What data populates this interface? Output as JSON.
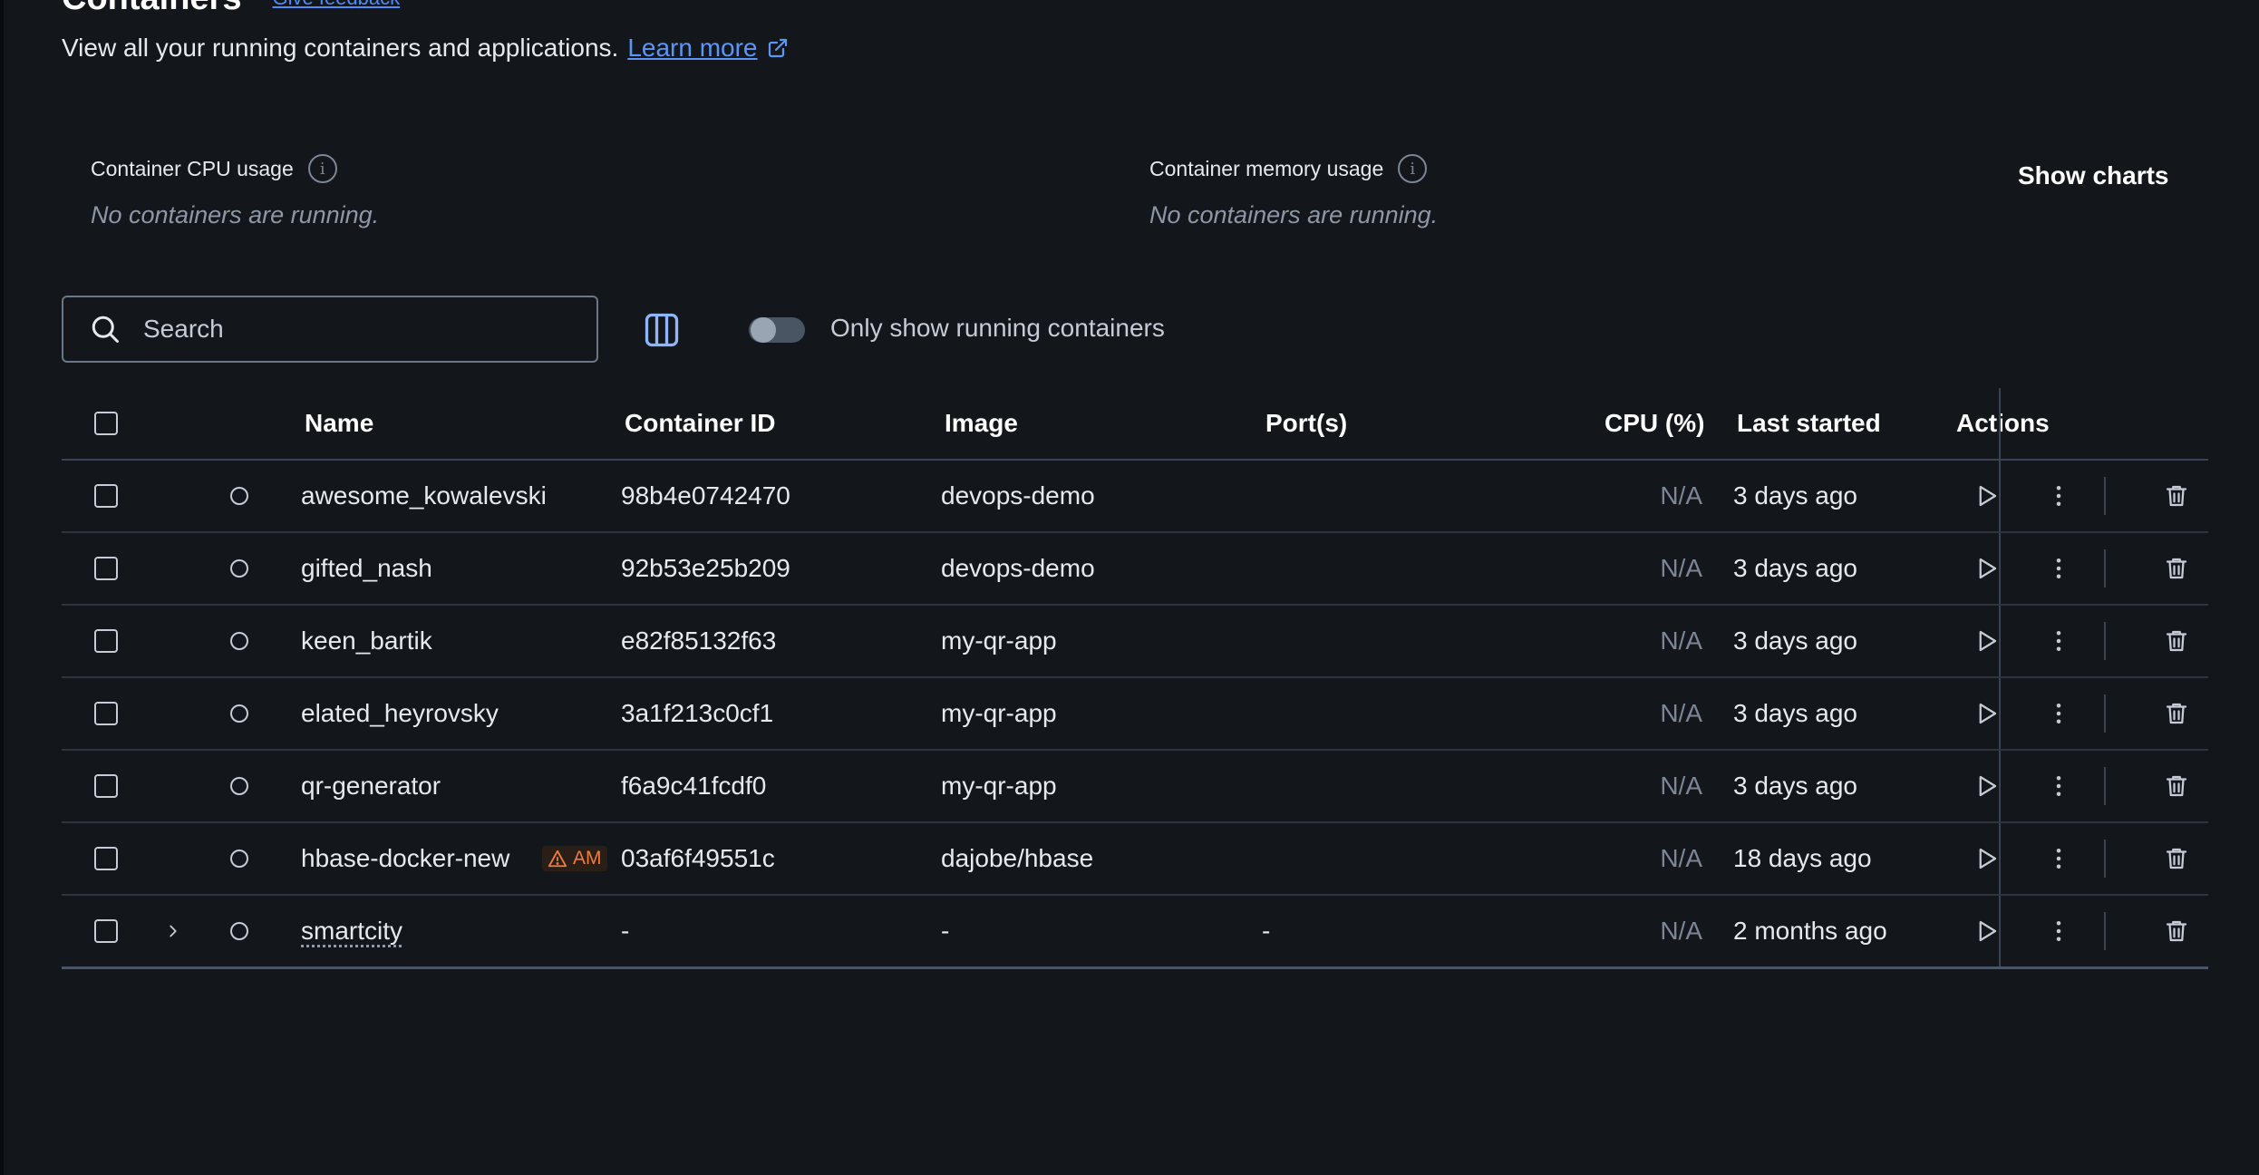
{
  "header": {
    "title": "Containers",
    "feedback_label": "Give feedback",
    "subtitle": "View all your running containers and applications.",
    "learn_more": "Learn more"
  },
  "stats": {
    "cpu": {
      "label": "Container CPU usage",
      "empty": "No containers are running."
    },
    "memory": {
      "label": "Container memory usage",
      "empty": "No containers are running."
    },
    "show_charts": "Show charts"
  },
  "toolbar": {
    "search_placeholder": "Search",
    "toggle_label": "Only show running containers",
    "toggle_on": false
  },
  "table": {
    "columns": {
      "name": "Name",
      "container_id": "Container ID",
      "image": "Image",
      "ports": "Port(s)",
      "cpu": "CPU (%)",
      "last_started": "Last started",
      "actions": "Actions"
    },
    "rows": [
      {
        "name": "awesome_kowalevski",
        "id": "98b4e0742470",
        "image": "devops-demo",
        "ports": "",
        "cpu": "N/A",
        "last_started": "3 days ago"
      },
      {
        "name": "gifted_nash",
        "id": "92b53e25b209",
        "image": "devops-demo",
        "ports": "",
        "cpu": "N/A",
        "last_started": "3 days ago"
      },
      {
        "name": "keen_bartik",
        "id": "e82f85132f63",
        "image": "my-qr-app",
        "ports": "",
        "cpu": "N/A",
        "last_started": "3 days ago"
      },
      {
        "name": "elated_heyrovsky",
        "id": "3a1f213c0cf1",
        "image": "my-qr-app",
        "ports": "",
        "cpu": "N/A",
        "last_started": "3 days ago"
      },
      {
        "name": "qr-generator",
        "id": "f6a9c41fcdf0",
        "image": "my-qr-app",
        "ports": "",
        "cpu": "N/A",
        "last_started": "3 days ago"
      },
      {
        "name": "hbase-docker-new",
        "badge": "AM",
        "id": "03af6f49551c",
        "image": "dajobe/hbase",
        "ports": "",
        "cpu": "N/A",
        "last_started": "18 days ago"
      },
      {
        "name": "smartcity",
        "id": "-",
        "image": "-",
        "ports": "-",
        "cpu": "N/A",
        "last_started": "2 months ago"
      }
    ]
  },
  "colors": {
    "background": "#13171c",
    "link": "#5b96f6",
    "warning": "#f07b3f",
    "border": "#3b4452"
  },
  "icons": [
    "external-link-icon",
    "info-icon",
    "search-icon",
    "columns-icon",
    "chevron-right-icon",
    "play-icon",
    "more-vertical-icon",
    "trash-icon",
    "warning-icon"
  ]
}
